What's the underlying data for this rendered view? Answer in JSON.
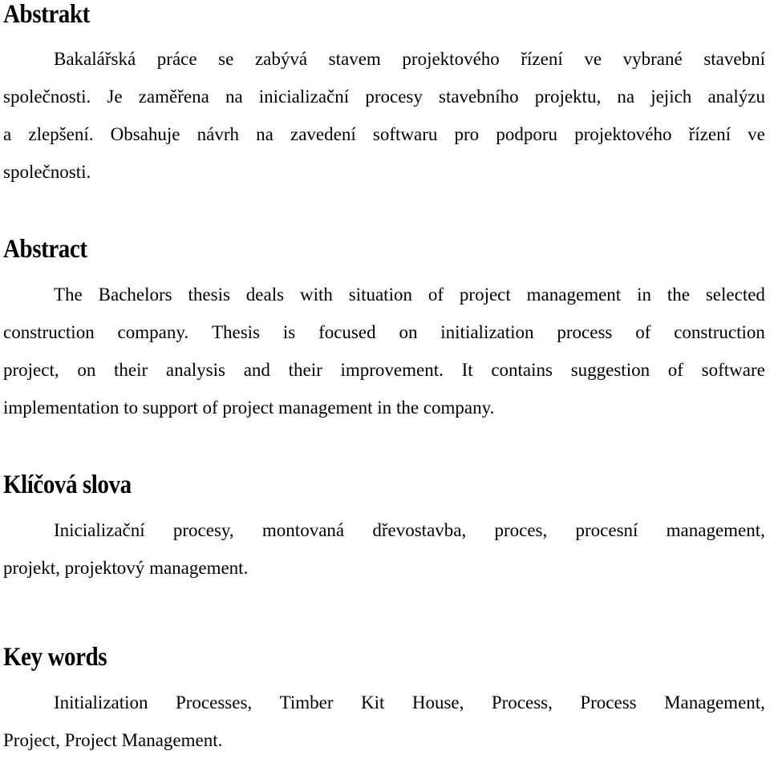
{
  "sections": [
    {
      "heading": "Abstrakt",
      "lines": [
        [
          "Bakalářská",
          "práce",
          "se",
          "zabývá",
          "stavem",
          "projektového",
          "řízení",
          "ve",
          "vybrané",
          "stavební"
        ],
        [
          "společnosti.",
          "Je",
          "zaměřena",
          "na",
          "inicializační",
          "procesy",
          "stavebního",
          "projektu,",
          "na",
          "jejich",
          "analýzu"
        ],
        [
          "a",
          "zlepšení.",
          "Obsahuje",
          "návrh",
          "na",
          "zavedení",
          "softwaru",
          "pro",
          "podporu",
          "projektového",
          "řízení",
          "ve"
        ],
        [
          "společnosti."
        ]
      ],
      "text": "Bakalářská práce se zabývá stavem projektového řízení ve vybrané stavební společnosti. Je zaměřena na inicializační procesy stavebního projektu, na jejich analýzu a zlepšení. Obsahuje návrh na zavedení softwaru pro podporu projektového řízení ve společnosti."
    },
    {
      "heading": "Abstract",
      "lines": [
        [
          "The",
          "Bachelors",
          "thesis",
          "deals",
          "with",
          "situation",
          "of",
          "project",
          "management",
          "in",
          "the",
          "selected"
        ],
        [
          "construction",
          "company.",
          "Thesis",
          "is",
          "focused",
          "on",
          "initialization",
          "process",
          "of",
          "construction"
        ],
        [
          "project,",
          "on",
          "their",
          "analysis",
          "and",
          "their",
          "improvement.",
          "It",
          "contains",
          "suggestion",
          "of",
          "software"
        ],
        [
          "implementation",
          "to",
          "support",
          "of",
          "project",
          "management",
          "in",
          "the",
          "company."
        ]
      ],
      "text": "The Bachelors thesis deals with situation of project management in the selected construction company. Thesis is focused on initialization process of construction project, on their analysis and their improvement. It contains suggestion of software implementation to support of project management in the company."
    },
    {
      "heading": "Klíčová slova",
      "lines": [
        [
          "Inicializační",
          "procesy,",
          "montovaná",
          "dřevostavba,",
          "proces,",
          "procesní",
          "management,"
        ],
        [
          "projekt,",
          "projektový",
          "management."
        ]
      ],
      "text": "Inicializační procesy, montovaná dřevostavba, proces, procesní management, projekt, projektový management."
    },
    {
      "heading": "Key words",
      "lines": [
        [
          "Initialization",
          "Processes,",
          "Timber",
          "Kit",
          "House,",
          "Process,",
          "Process",
          "Management,"
        ],
        [
          "Project,",
          "Project",
          "Management."
        ]
      ],
      "text": "Initialization Processes, Timber Kit House, Process, Process Management, Project, Project Management."
    }
  ]
}
